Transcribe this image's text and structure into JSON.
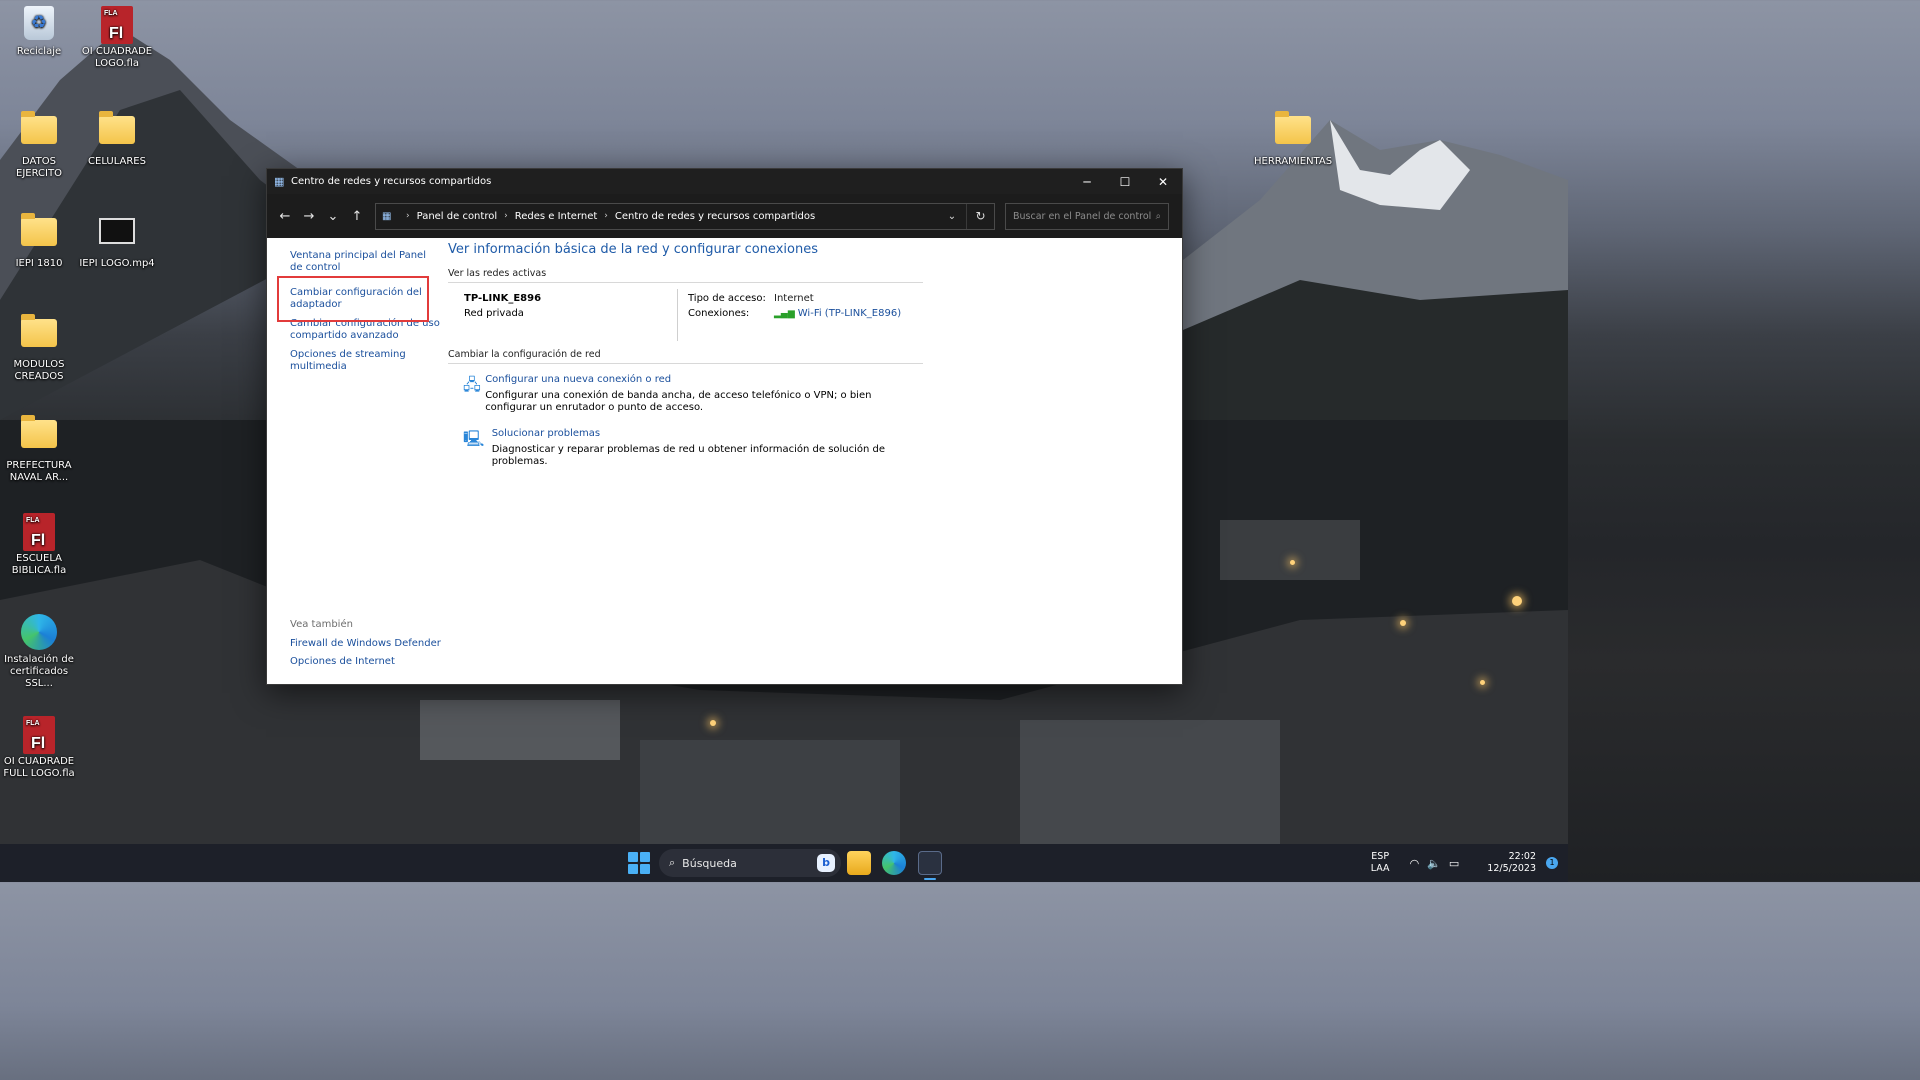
{
  "desktop": {
    "icons_left": [
      {
        "label": "Reciclaje",
        "kind": "recycle-bin"
      },
      {
        "label": "OI CUADRADE LOGO.fla",
        "kind": "flash-file"
      },
      {
        "label": "DATOS EJERCITO",
        "kind": "folder"
      },
      {
        "label": "CELULARES",
        "kind": "folder"
      },
      {
        "label": "IEPI 1810",
        "kind": "folder"
      },
      {
        "label": "IEPI LOGO.mp4",
        "kind": "video-file"
      },
      {
        "label": "MODULOS CREADOS",
        "kind": "folder"
      },
      {
        "label": "PREFECTURA NAVAL AR...",
        "kind": "folder"
      },
      {
        "label": "ESCUELA BIBLICA.fla",
        "kind": "flash-file"
      },
      {
        "label": "Instalación de certificados SSL...",
        "kind": "edge-shortcut"
      },
      {
        "label": "OI CUADRADE FULL LOGO.fla",
        "kind": "flash-file"
      }
    ],
    "icons_right": [
      {
        "label": "HERRAMIENTAS",
        "kind": "folder"
      }
    ],
    "fla_tag": "FLA",
    "fla_mark": "Fl"
  },
  "window": {
    "title": "Centro de redes y recursos compartidos",
    "controls": {
      "minimize": "─",
      "maximize": "☐",
      "close": "✕"
    },
    "nav": {
      "back": "←",
      "forward": "→",
      "recent": "⌄",
      "up": "↑"
    },
    "breadcrumb": [
      "Panel de control",
      "Redes e Internet",
      "Centro de redes y recursos compartidos"
    ],
    "search_placeholder": "Buscar en el Panel de control",
    "left_links": [
      "Ventana principal del Panel de control",
      "Cambiar configuración del adaptador",
      "Cambiar configuración de uso compartido avanzado",
      "Opciones de streaming multimedia"
    ],
    "see_also": {
      "header": "Vea también",
      "links": [
        "Firewall de Windows Defender",
        "Opciones de Internet"
      ]
    },
    "main": {
      "heading": "Ver información básica de la red y configurar conexiones",
      "active_networks_label": "Ver las redes activas",
      "network": {
        "name": "TP-LINK_E896",
        "type": "Red privada",
        "access_label": "Tipo de acceso:",
        "access_value": "Internet",
        "connections_label": "Conexiones:",
        "connections_value": "Wi-Fi (TP-LINK_E896)"
      },
      "change_settings_label": "Cambiar la configuración de red",
      "tasks": [
        {
          "title": "Configurar una nueva conexión o red",
          "description": "Configurar una conexión de banda ancha, de acceso telefónico o VPN; o bien configurar un enrutador o punto de acceso.",
          "icon": "network-setup-icon"
        },
        {
          "title": "Solucionar problemas",
          "description": "Diagnosticar y reparar problemas de red u obtener información de solución de problemas.",
          "icon": "troubleshoot-icon"
        }
      ]
    }
  },
  "taskbar": {
    "search_text": "Búsqueda",
    "bing_label": "b",
    "language": "ESP",
    "layout": "LAA",
    "time": "22:02",
    "date": "12/5/2023",
    "notification_count": "1"
  },
  "colors": {
    "link": "#1a4f9c",
    "heading": "#1f5ba8",
    "highlight": "#e23b3b",
    "titlebar": "#1f1f1f",
    "taskbar": "#1d2029"
  }
}
